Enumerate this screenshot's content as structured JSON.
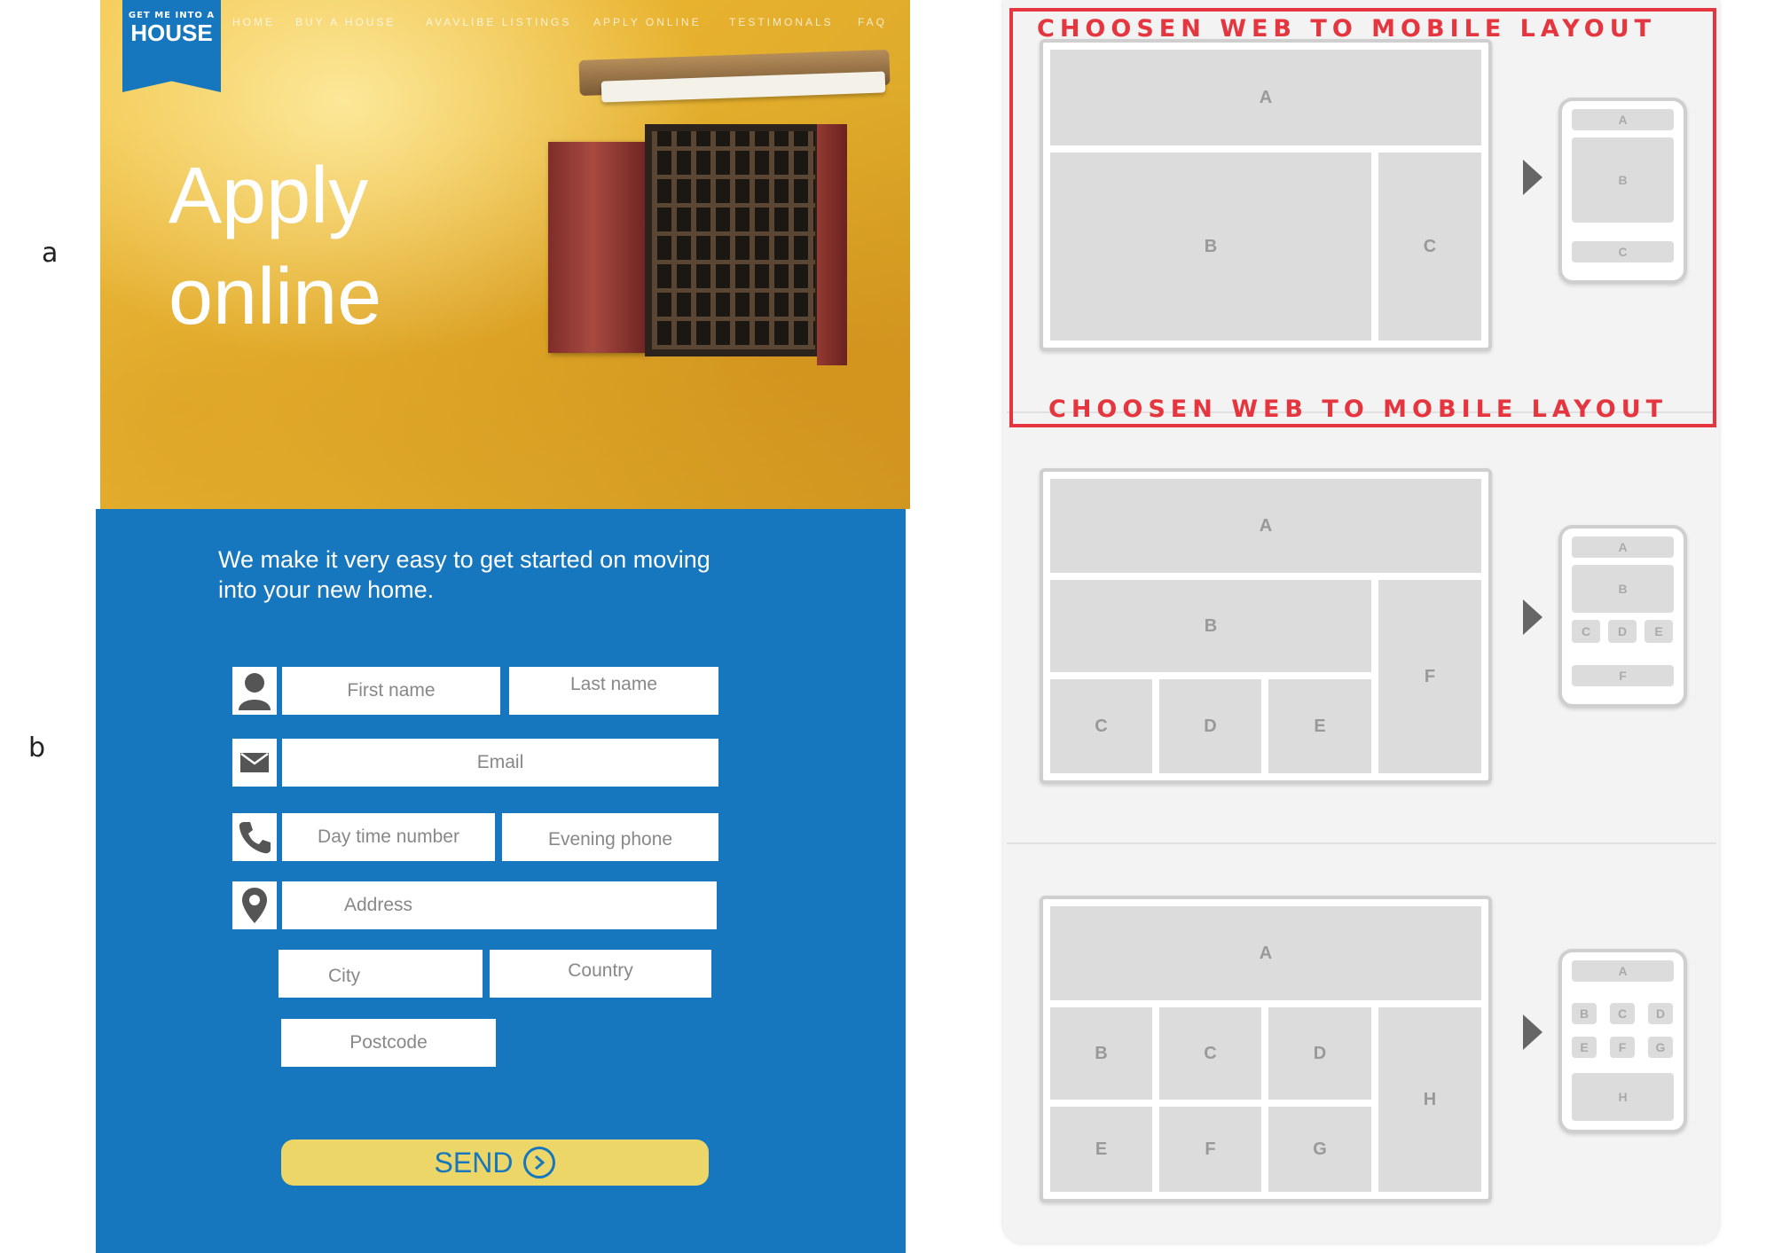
{
  "labels": {
    "a": "a",
    "b": "b"
  },
  "hero": {
    "logo_small": "GET ME INTO A",
    "logo_big": "HOUSE",
    "nav": [
      "HOME",
      "BUY A HOUSE",
      "AVAVLIBE LISTINGS",
      "APPLY ONLINE",
      "TESTIMONALS",
      "FAQ"
    ],
    "title_line1": "Apply",
    "title_line2": "online"
  },
  "form": {
    "intro": "We  make it very easy to get started on moving into your new home.",
    "first_name": "First name",
    "last_name": "Last name",
    "email": "Email",
    "day_phone": "Day time number",
    "evening_phone": "Evening phone",
    "address": "Address",
    "city": "City",
    "country": "Country",
    "postcode": "Postcode",
    "send": "SEND"
  },
  "layouts": {
    "selected_title": "CHOOSEN WEB TO MOBILE LAYOUT",
    "selected_title_2": "CHOOSEN WEB TO MOBILE LAYOUT",
    "accent_color": "#e5363f",
    "layout1": {
      "desktop": [
        "A",
        "B",
        "C"
      ],
      "mobile": [
        "A",
        "B",
        "C"
      ]
    },
    "layout2": {
      "desktop": [
        "A",
        "B",
        "C",
        "D",
        "E",
        "F"
      ],
      "mobile": [
        "A",
        "B",
        "C",
        "D",
        "E",
        "F"
      ]
    },
    "layout3": {
      "desktop": [
        "A",
        "B",
        "C",
        "D",
        "E",
        "F",
        "G",
        "H"
      ],
      "mobile": [
        "A",
        "B",
        "C",
        "D",
        "E",
        "F",
        "G",
        "H"
      ]
    }
  }
}
